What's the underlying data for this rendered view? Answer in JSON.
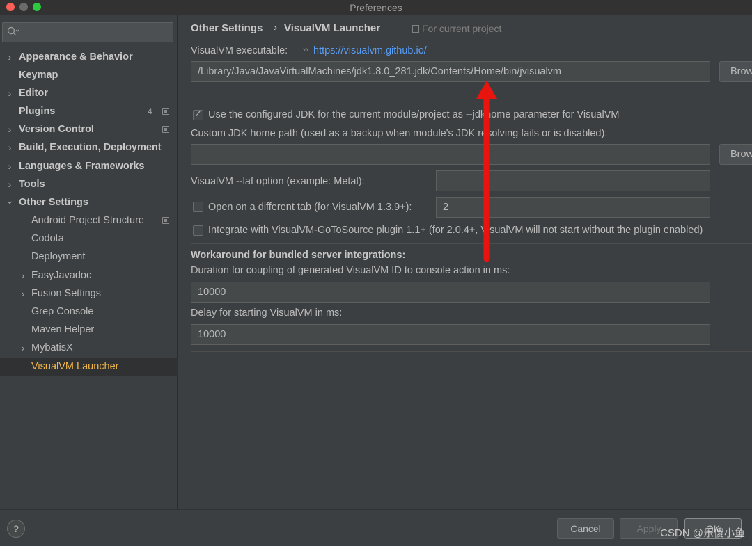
{
  "window": {
    "title": "Preferences"
  },
  "sidebar": {
    "search_placeholder": "",
    "items": [
      {
        "label": "Appearance & Behavior",
        "chevron": "›",
        "badge": ""
      },
      {
        "label": "Keymap",
        "chevron": "",
        "badge": ""
      },
      {
        "label": "Editor",
        "chevron": "›",
        "badge": ""
      },
      {
        "label": "Plugins",
        "chevron": "",
        "badge": "4"
      },
      {
        "label": "Version Control",
        "chevron": "›",
        "badge": ""
      },
      {
        "label": "Build, Execution, Deployment",
        "chevron": "›",
        "badge": ""
      },
      {
        "label": "Languages & Frameworks",
        "chevron": "›",
        "badge": ""
      },
      {
        "label": "Tools",
        "chevron": "›",
        "badge": ""
      },
      {
        "label": "Other Settings",
        "chevron": "⌄",
        "badge": ""
      },
      {
        "label": "Android Project Structure",
        "chevron": "",
        "badge": ""
      },
      {
        "label": "Codota",
        "chevron": "",
        "badge": ""
      },
      {
        "label": "Deployment",
        "chevron": "",
        "badge": ""
      },
      {
        "label": "EasyJavadoc",
        "chevron": "›",
        "badge": ""
      },
      {
        "label": "Fusion Settings",
        "chevron": "›",
        "badge": ""
      },
      {
        "label": "Grep Console",
        "chevron": "",
        "badge": ""
      },
      {
        "label": "Maven Helper",
        "chevron": "",
        "badge": ""
      },
      {
        "label": "MybatisX",
        "chevron": "›",
        "badge": ""
      },
      {
        "label": "VisualVM Launcher",
        "chevron": "",
        "badge": ""
      }
    ]
  },
  "main": {
    "breadcrumb": [
      "Other Settings",
      "VisualVM Launcher"
    ],
    "breadcrumb_sep": "›",
    "for_current_project": "For current project",
    "executable_label": "VisualVM executable:",
    "link_glyph": "››",
    "executable_link": "https://visualvm.github.io/",
    "executable_path": "/Library/Java/JavaVirtualMachines/jdk1.8.0_281.jdk/Contents/Home/bin/jvisualvm",
    "browse_label": "Browse...",
    "use_jdk_label": "Use the configured JDK for the current module/project as --jdkhome parameter for VisualVM",
    "use_jdk_checked": true,
    "custom_jdk_label": "Custom JDK home path (used as a backup when module's JDK resolving fails or is disabled):",
    "custom_jdk_value": "",
    "laf_label": "VisualVM --laf option (example: Metal):",
    "laf_value": "",
    "open_tab_label": "Open on a different tab (for VisualVM 1.3.9+):",
    "open_tab_value": "2",
    "open_tab_checked": false,
    "gotosource_label": "Integrate with VisualVM-GoToSource plugin 1.1+ (for 2.0.4+, VisualVM will not start without the plugin enabled)",
    "gotosource_checked": false,
    "workaround_heading": "Workaround for bundled server integrations:",
    "duration_label": "Duration for coupling of generated VisualVM ID to console action in ms:",
    "duration_value": "10000",
    "delay_label": "Delay for starting VisualVM in ms:",
    "delay_value": "10000"
  },
  "footer": {
    "help": "?",
    "cancel": "Cancel",
    "apply": "Apply",
    "ok": "OK",
    "watermark": "CSDN @乐傻小鱼"
  },
  "colors": {
    "accent_selected": "#f0b54a",
    "link": "#589df6",
    "arrow": "#e8150f"
  }
}
